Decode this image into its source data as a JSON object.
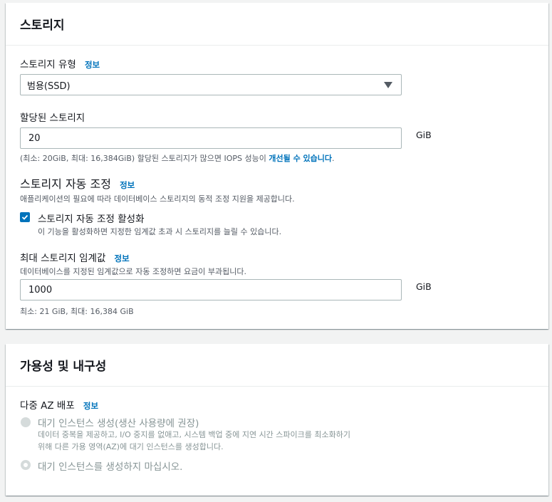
{
  "storage": {
    "title": "스토리지",
    "type_label": "스토리지 유형",
    "info": "정보",
    "type_value": "범용(SSD)",
    "allocated_label": "할당된 스토리지",
    "allocated_value": "20",
    "unit": "GiB",
    "allocated_hint_pre": "(최소: 20GiB, 최대: 16,384GiB) 할당된 스토리지가 많으면 IOPS 성능이 ",
    "allocated_hint_link": "개선될 수 있습니다",
    "allocated_hint_post": ".",
    "autoscaling_title": "스토리지 자동 조정",
    "autoscaling_desc": "애플리케이션의 필요에 따라 데이터베이스 스토리지의 동적 조정 지원을 제공합니다.",
    "autoscaling_checkbox_label": "스토리지 자동 조정 활성화",
    "autoscaling_checkbox_desc": "이 기능을 활성화하면 지정한 임계값 초과 시 스토리지를 늘릴 수 있습니다.",
    "autoscaling_checked": true,
    "max_threshold_label": "최대 스토리지 임계값",
    "max_threshold_desc": "데이터베이스를 지정된 임계값으로 자동 조정하면 요금이 부과됩니다.",
    "max_threshold_value": "1000",
    "max_threshold_hint": "최소: 21 GiB, 최대: 16,384 GiB"
  },
  "availability": {
    "title": "가용성 및 내구성",
    "multi_az_label": "다중 AZ 배포",
    "info": "정보",
    "option1_label": "대기 인스턴스 생성(생산 사용량에 권장)",
    "option1_desc_line1": "데이터 중복을 제공하고, I/O 중지를 없애고, 시스템 백업 중에 지연 시간 스파이크를 최소화하기",
    "option1_desc_line2": "위해 다른 가용 영역(AZ)에 대기 인스턴스를 생성합니다.",
    "option2_label": "대기 인스턴스를 생성하지 마십시오."
  },
  "colors": {
    "accent": "#0073bb",
    "background": "#f2f3f3",
    "text": "#16191f",
    "secondary_text": "#545b64",
    "disabled_text": "#879596"
  }
}
